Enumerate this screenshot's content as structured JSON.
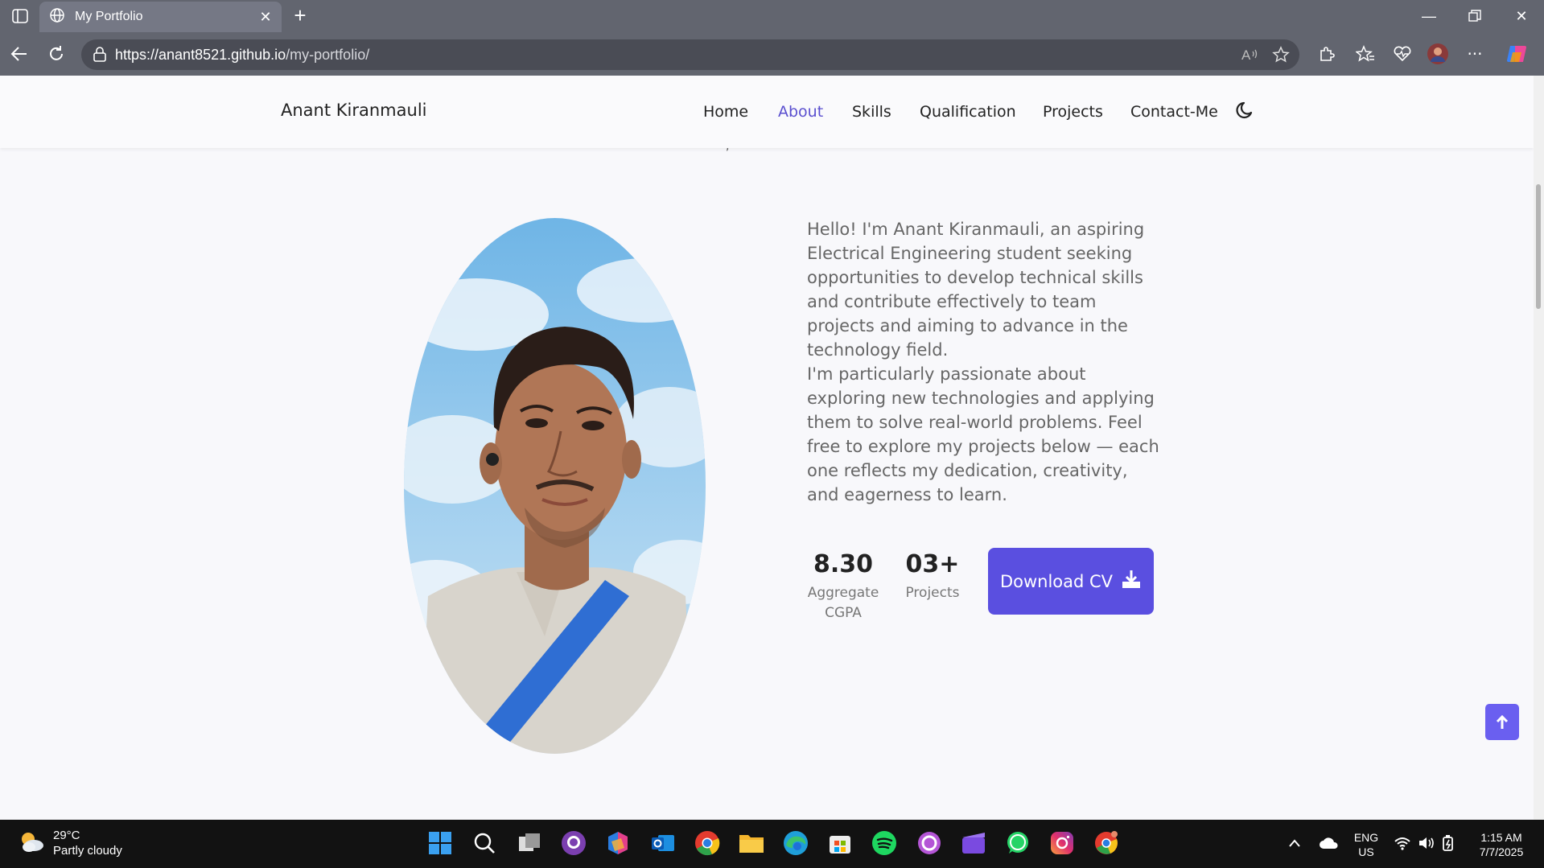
{
  "browser": {
    "tab_title": "My Portfolio",
    "url_host": "https://anant8521.github.io",
    "url_path": "/my-portfolio/"
  },
  "navbar": {
    "brand": "Anant Kiranmauli",
    "links": [
      "Home",
      "About",
      "Skills",
      "Qualification",
      "Projects",
      "Contact-Me"
    ],
    "active": "About"
  },
  "about": {
    "paragraph1": "Hello! I'm Anant Kiranmauli, an aspiring Electrical Engineering student seeking opportunities to develop technical skills and contribute effectively to team projects and aiming to advance in the technology field.",
    "paragraph2": "I'm particularly passionate about exploring new technologies and applying them to solve real-world problems. Feel free to explore my projects below — each one reflects my dedication, creativity, and eagerness to learn.",
    "stats": [
      {
        "value": "8.30",
        "label": "Aggregate CGPA"
      },
      {
        "value": "03+",
        "label": "Projects"
      }
    ],
    "download_label": "Download CV"
  },
  "taskbar": {
    "weather_temp": "29°C",
    "weather_desc": "Partly cloudy",
    "lang_line1": "ENG",
    "lang_line2": "US",
    "time": "1:15 AM",
    "date": "7/7/2025"
  },
  "colors": {
    "accent": "#5a4fe0",
    "nav_active": "#5a4fcf",
    "chrome": "#62656f",
    "taskbar": "#121212"
  }
}
